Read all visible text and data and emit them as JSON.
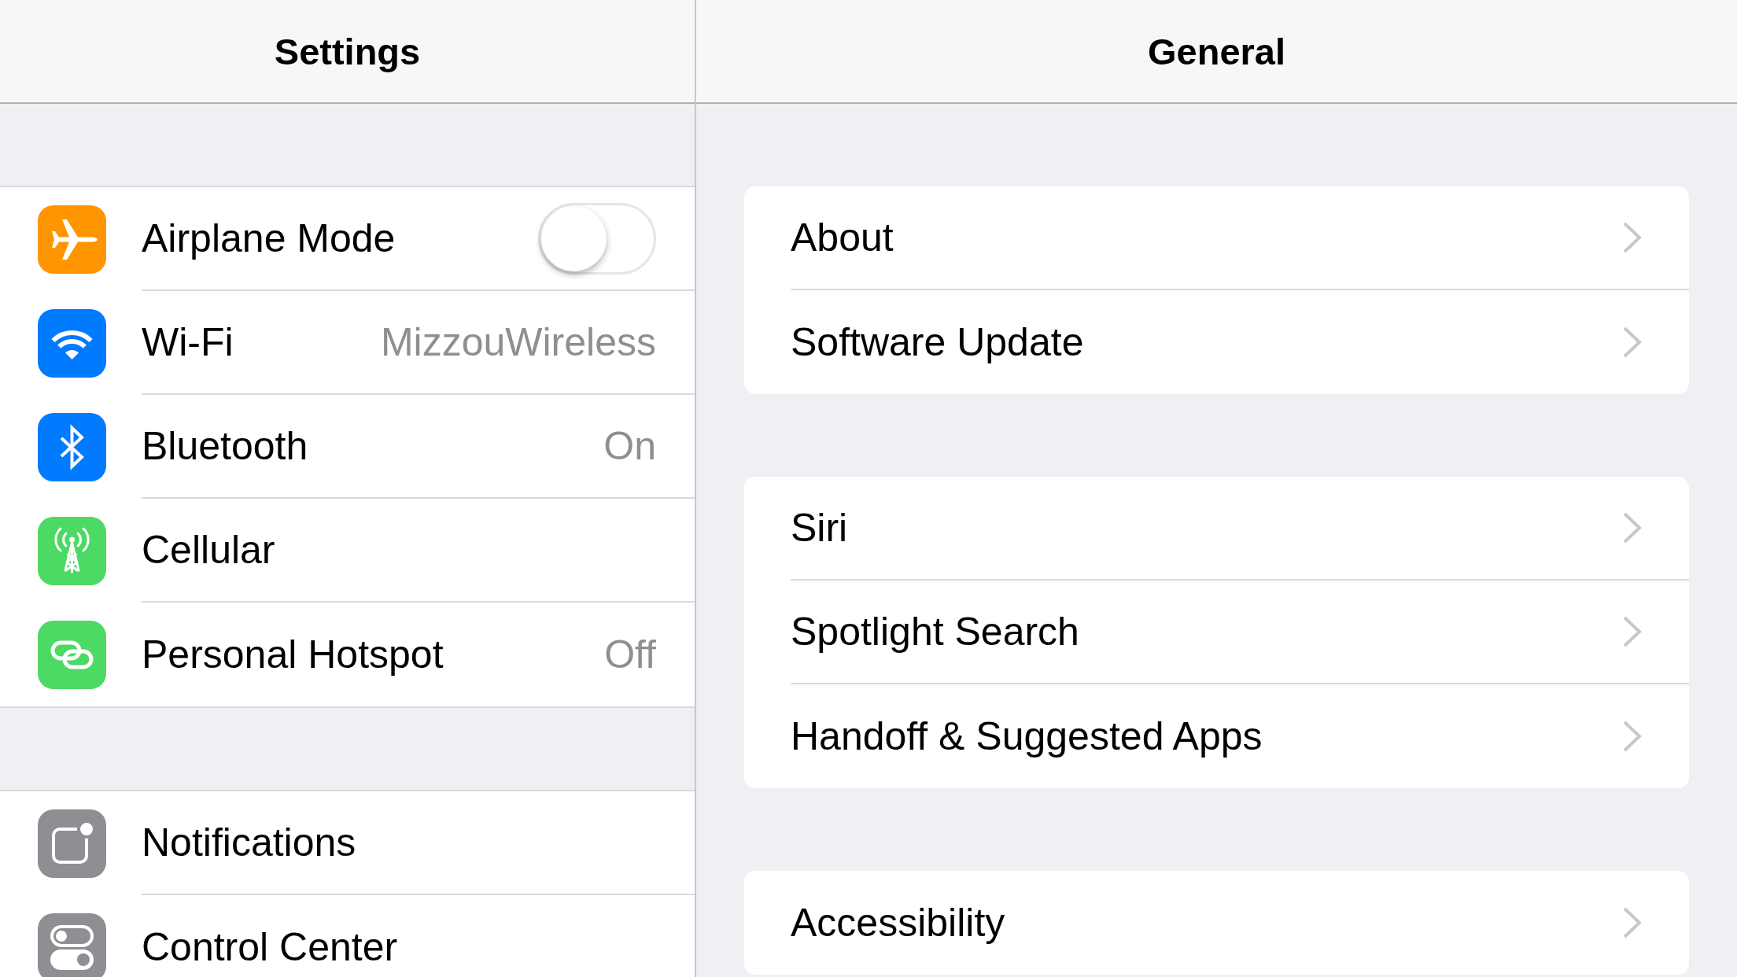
{
  "sidebar": {
    "title": "Settings",
    "groups": [
      {
        "items": [
          {
            "kind": "toggle",
            "label": "Airplane Mode",
            "color": "#ff9500",
            "on": false
          },
          {
            "kind": "link",
            "label": "Wi-Fi",
            "color": "#007aff",
            "value": "MizzouWireless"
          },
          {
            "kind": "link",
            "label": "Bluetooth",
            "color": "#007aff",
            "value": "On"
          },
          {
            "kind": "link",
            "label": "Cellular",
            "color": "#4cd964"
          },
          {
            "kind": "link",
            "label": "Personal Hotspot",
            "color": "#4cd964",
            "value": "Off"
          }
        ]
      },
      {
        "items": [
          {
            "kind": "link",
            "label": "Notifications",
            "color": "#8e8e93"
          },
          {
            "kind": "link",
            "label": "Control Center",
            "color": "#8e8e93"
          }
        ]
      }
    ]
  },
  "detail": {
    "title": "General",
    "groups": [
      {
        "items": [
          {
            "label": "About"
          },
          {
            "label": "Software Update"
          }
        ]
      },
      {
        "items": [
          {
            "label": "Siri"
          },
          {
            "label": "Spotlight Search"
          },
          {
            "label": "Handoff & Suggested Apps"
          }
        ]
      },
      {
        "items": [
          {
            "label": "Accessibility"
          }
        ]
      }
    ]
  }
}
